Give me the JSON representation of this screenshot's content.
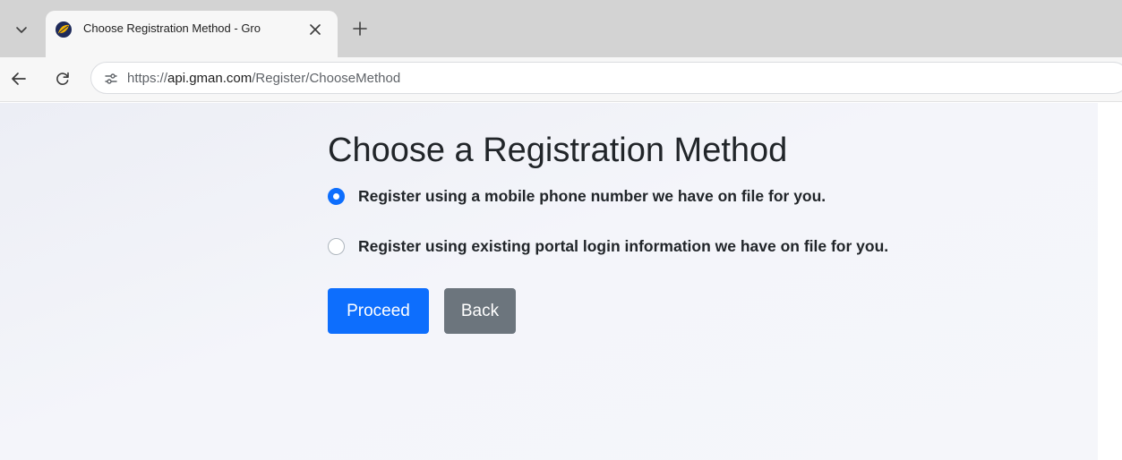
{
  "browser": {
    "tab": {
      "title": "Choose Registration Method - Gro",
      "favicon": "leaf-logo-icon"
    },
    "address_bar": {
      "scheme": "https://",
      "host": "api.gman.com",
      "path": "/Register/ChooseMethod",
      "site_info_icon": "tune-icon"
    }
  },
  "page": {
    "title": "Choose a Registration Method",
    "options": [
      {
        "label": "Register using a mobile phone number we have on file for you.",
        "selected": true
      },
      {
        "label": "Register using existing portal login information we have on file for you.",
        "selected": false
      }
    ],
    "buttons": {
      "proceed_label": "Proceed",
      "back_label": "Back"
    }
  },
  "colors": {
    "primary": "#0d6efd",
    "secondary": "#6c757d",
    "text": "#212529",
    "page_background": "#f4f5fa"
  }
}
